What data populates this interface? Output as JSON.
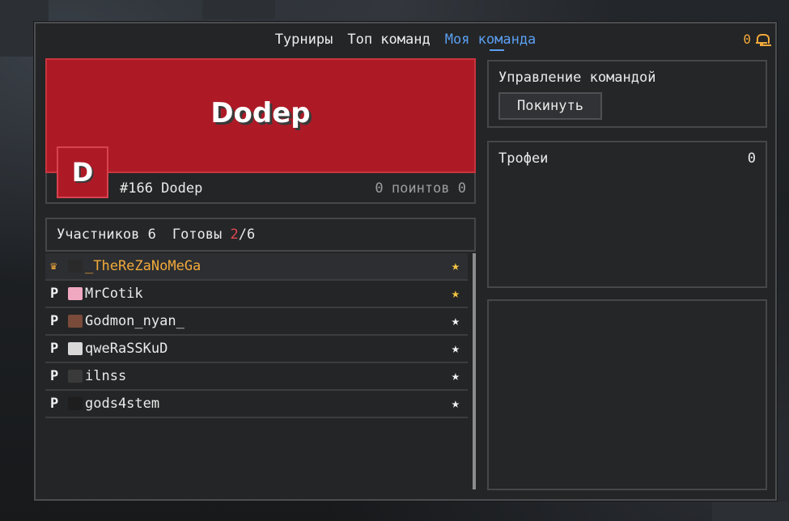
{
  "tabs": [
    {
      "label": "Турниры",
      "active": false
    },
    {
      "label": "Топ команд",
      "active": false
    },
    {
      "label": "Моя команда",
      "active": true
    }
  ],
  "notifications": {
    "count": "0",
    "icon": "bell-icon"
  },
  "team": {
    "name": "Dodep",
    "logo_letter": "D",
    "tag": "#166 Dodep",
    "points": "0 поинтов 0",
    "banner_color": "#ad1a26"
  },
  "members_header": {
    "members_label": "Участников 6",
    "ready_label": "Готовы",
    "ready_count": "2",
    "ready_total": "/6"
  },
  "members": [
    {
      "role": "leader",
      "nick": "_TheReZaNoMeGa",
      "star": "gold",
      "avatar_color": "#2a2a2a"
    },
    {
      "role": "P",
      "nick": "MrCotik",
      "star": "gold",
      "avatar_color": "#f0a8c0"
    },
    {
      "role": "P",
      "nick": "Godmon_nyan_",
      "star": "white",
      "avatar_color": "#7a4a3a"
    },
    {
      "role": "P",
      "nick": "qweRaSSKuD",
      "star": "white",
      "avatar_color": "#d8d8d8"
    },
    {
      "role": "P",
      "nick": "ilnss",
      "star": "white",
      "avatar_color": "#3a3a3a"
    },
    {
      "role": "P",
      "nick": "gods4stem",
      "star": "white",
      "avatar_color": "#1e1e1e"
    }
  ],
  "management": {
    "title": "Управление командой",
    "leave_label": "Покинуть"
  },
  "trophies": {
    "title": "Трофеи",
    "count": "0"
  }
}
